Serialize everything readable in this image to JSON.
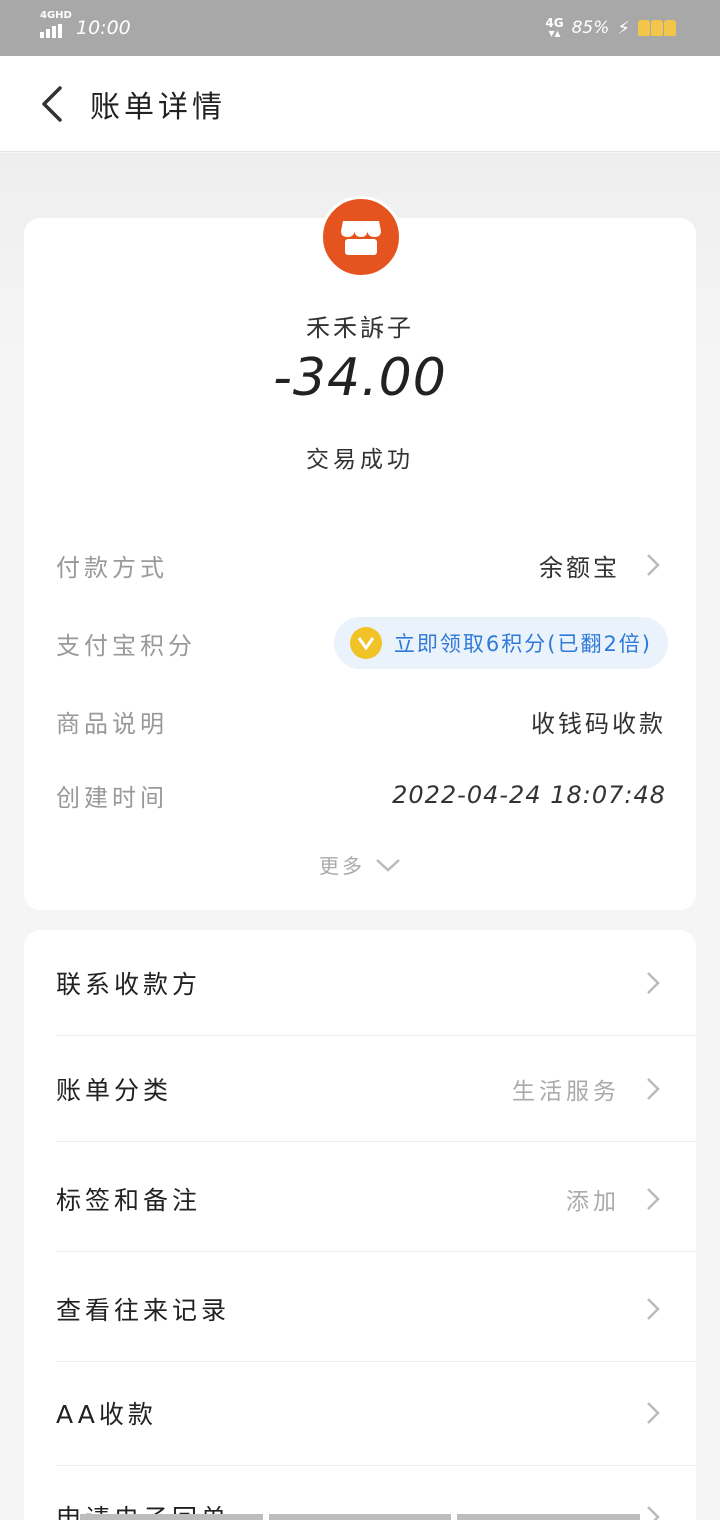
{
  "status_bar": {
    "network": "4GHD",
    "time": "10:00",
    "net_type": "4G",
    "battery": "85%"
  },
  "header": {
    "title": "账单详情"
  },
  "merchant": {
    "name": "禾禾訴子"
  },
  "bill": {
    "amount": "-34.00",
    "status": "交易成功",
    "payment_method_label": "付款方式",
    "payment_method_value": "余额宝",
    "points_label": "支付宝积分",
    "points_value": "立即领取6积分(已翻2倍)",
    "product_label": "商品说明",
    "product_value": "收钱码收款",
    "created_label": "创建时间",
    "created_value": "2022-04-24 18:07:48",
    "more_label": "更多"
  },
  "menu": [
    {
      "label": "联系收款方",
      "value": ""
    },
    {
      "label": "账单分类",
      "value": "生活服务"
    },
    {
      "label": "标签和备注",
      "value": "添加"
    },
    {
      "label": "查看往来记录",
      "value": ""
    },
    {
      "label": "AA收款",
      "value": ""
    },
    {
      "label": "申请电子回单",
      "value": ""
    }
  ],
  "colors": {
    "accent": "#e5541f",
    "link": "#2f7ad8",
    "pill_bg": "#eaf2fc",
    "coin": "#f2c327"
  }
}
